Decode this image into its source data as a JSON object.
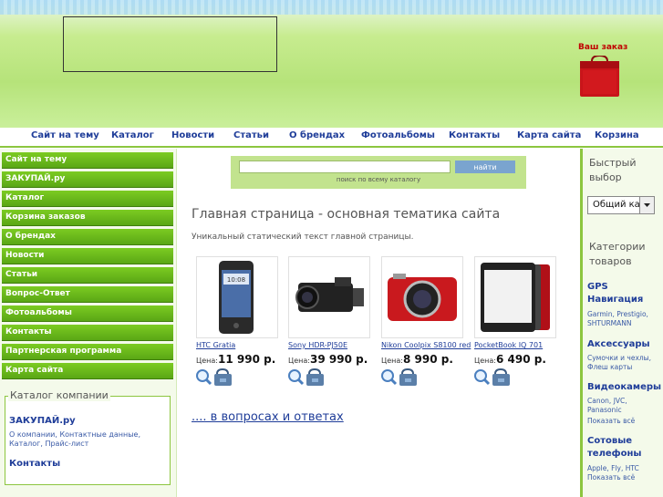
{
  "header": {
    "order_title": "Ваш заказ"
  },
  "topnav": [
    {
      "label": "Сайт на тему"
    },
    {
      "label": "Каталог"
    },
    {
      "label": "Новости"
    },
    {
      "label": "Статьи"
    },
    {
      "label": "О брендах"
    },
    {
      "label": "Фотоальбомы"
    },
    {
      "label": "Контакты"
    },
    {
      "label": "Карта сайта"
    },
    {
      "label": "Корзина"
    }
  ],
  "leftnav": [
    {
      "label": "Сайт на тему"
    },
    {
      "label": "ЗАКУПАЙ.ру"
    },
    {
      "label": "Каталог"
    },
    {
      "label": "Корзина заказов"
    },
    {
      "label": "О брендах"
    },
    {
      "label": "Новости"
    },
    {
      "label": "Статьи"
    },
    {
      "label": "Вопрос-Ответ"
    },
    {
      "label": "Фотоальбомы"
    },
    {
      "label": "Контакты"
    },
    {
      "label": "Партнерская программа"
    },
    {
      "label": "Карта сайта"
    }
  ],
  "company_catalog": {
    "legend": "Каталог компании",
    "company_name": "ЗАКУПАЙ.ру",
    "company_links": "О компании, Контактные данные, Каталог, Прайс-лист",
    "contacts": "Контакты"
  },
  "search": {
    "input_value": "",
    "button_label": "найти",
    "hint": "поиск по всему каталогу"
  },
  "main": {
    "title": "Главная страница - основная тематика сайта",
    "description": "Уникальный статический текст главной страницы.",
    "qa_link": ".... в вопросах и ответах"
  },
  "products": [
    {
      "name": "HTC Gratia",
      "price_label": "Цена:",
      "price": "11 990 р."
    },
    {
      "name": "Sony HDR-PJ50E",
      "price_label": "Цена:",
      "price": "39 990 р."
    },
    {
      "name": "Nikon Coolpix S8100 red",
      "price_label": "Цена:",
      "price": "8 990 р."
    },
    {
      "name": "PocketBook IQ 701",
      "price_label": "Цена:",
      "price": "6 490 р."
    }
  ],
  "right": {
    "quick_title": "Быстрый выбор",
    "select_value": "Общий каталог",
    "categories_title": "Категории товаров",
    "categories": [
      {
        "name": "GPS Навигация",
        "sub": "Garmin, Prestigio, SHTURMANN",
        "show_all": ""
      },
      {
        "name": "Аксессуары",
        "sub": "Сумочки и чехлы, Флеш карты",
        "show_all": ""
      },
      {
        "name": "Видеокамеры",
        "sub": "Canon, JVC, Panasonic",
        "show_all": "Показать всё"
      },
      {
        "name": "Сотовые телефоны",
        "sub": "Apple, Fly, HTC",
        "show_all": "Показать всё"
      }
    ]
  },
  "colors": {
    "nav_green": "#6bb81b",
    "link_blue": "#1f3d99",
    "order_red": "#c00000"
  }
}
